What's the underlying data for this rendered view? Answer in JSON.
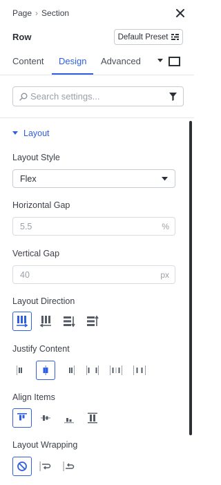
{
  "breadcrumb": {
    "page": "Page",
    "section": "Section"
  },
  "header": {
    "element": "Row",
    "preset_label": "Default Preset"
  },
  "tabs": [
    {
      "label": "Content",
      "active": false
    },
    {
      "label": "Design",
      "active": true
    },
    {
      "label": "Advanced",
      "active": false
    }
  ],
  "search": {
    "placeholder": "Search settings..."
  },
  "section": {
    "title": "Layout",
    "expanded": true
  },
  "fields": {
    "layout_style": {
      "label": "Layout Style",
      "value": "Flex"
    },
    "horizontal_gap": {
      "label": "Horizontal Gap",
      "value": "5.5",
      "unit": "%"
    },
    "vertical_gap": {
      "label": "Vertical Gap",
      "value": "40",
      "unit": "px"
    },
    "layout_direction": {
      "label": "Layout Direction",
      "selected": "row",
      "options": [
        "row-icon",
        "row-reverse-icon",
        "column-icon",
        "column-reverse-icon"
      ]
    },
    "justify_content": {
      "label": "Justify Content",
      "selected": "center",
      "options": [
        "justify-start-icon",
        "justify-center-icon",
        "justify-end-icon",
        "justify-space-between-icon",
        "justify-space-around-icon",
        "justify-space-evenly-icon"
      ]
    },
    "align_items": {
      "label": "Align Items",
      "selected": "start",
      "options": [
        "align-start-icon",
        "align-center-icon",
        "align-end-icon",
        "align-stretch-icon"
      ]
    },
    "layout_wrapping": {
      "label": "Layout Wrapping",
      "selected": "nowrap",
      "options": [
        "no-wrap-icon",
        "wrap-icon",
        "wrap-reverse-icon"
      ]
    }
  },
  "colors": {
    "accent": "#2f5fe0",
    "text": "#2b2f36",
    "muted": "#9aa0a8",
    "border": "#c7ccd3"
  }
}
